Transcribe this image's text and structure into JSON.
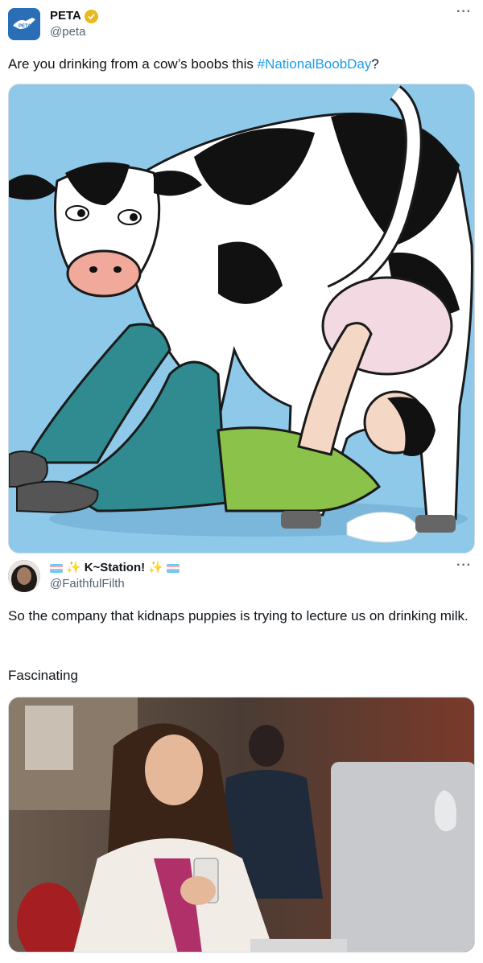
{
  "tweet1": {
    "display_name": "PETA",
    "handle": "@peta",
    "avatar_text": "PETA",
    "more": "···",
    "text_before": "Are you drinking from a cow’s boobs this ",
    "hashtag": "#NationalBoobDay",
    "text_after": "?"
  },
  "tweet2": {
    "display_name": "K~Station!",
    "handle": "@FaithfulFilth",
    "more": "···",
    "text_line1": "So the company that kidnaps puppies is trying to lecture us on drinking milk.",
    "text_line2": "Fascinating"
  },
  "colors": {
    "brand_blue": "#1d9bf0",
    "peta_blue": "#2a6fb6",
    "verified_gold": "#e8b820",
    "illustration_sky": "#8fc9ea"
  },
  "icons": [
    "verified-badge-icon",
    "more-options-icon",
    "trans-flag-icon",
    "sparkles-icon"
  ]
}
